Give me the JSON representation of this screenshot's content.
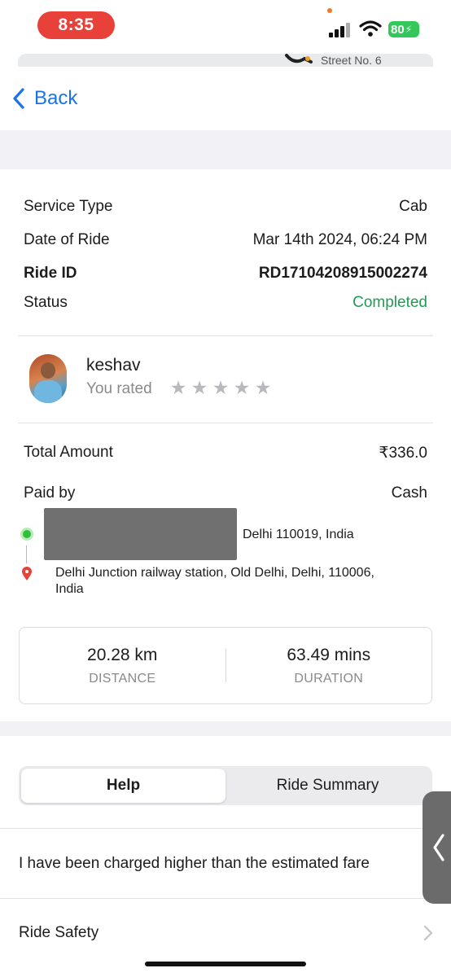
{
  "status_bar": {
    "time": "8:35",
    "battery": "80"
  },
  "map": {
    "street": "Street No. 6"
  },
  "nav": {
    "back_label": "Back"
  },
  "details": [
    {
      "key": "Service Type",
      "value": "Cab"
    },
    {
      "key": "Date of Ride",
      "value": "Mar 14th 2024, 06:24 PM"
    },
    {
      "key": "Ride ID",
      "value": "RD17104208915002274"
    },
    {
      "key": "Status",
      "value": "Completed"
    }
  ],
  "driver": {
    "name": "keshav",
    "rated_label": "You rated",
    "rating": 0,
    "max_rating": 5
  },
  "payment": [
    {
      "key": "Total Amount",
      "value": "₹336.0"
    },
    {
      "key": "Paid by",
      "value": "Cash"
    }
  ],
  "route": {
    "pickup_visible": "Delhi 110019, India",
    "drop": "Delhi Junction railway station, Old Delhi, Delhi, 110006, India"
  },
  "stats": [
    {
      "value": "20.28 km",
      "label": "DISTANCE"
    },
    {
      "value": "63.49 mins",
      "label": "DURATION"
    }
  ],
  "tabs": [
    {
      "label": "Help",
      "active": true
    },
    {
      "label": "Ride Summary",
      "active": false
    }
  ],
  "help_items": [
    "I have been charged higher than the estimated fare",
    "Ride Safety"
  ],
  "colors": {
    "accent_blue": "#1a73e8",
    "status_green": "#1e9c52",
    "time_pill": "#e8413a",
    "battery": "#34c759"
  }
}
